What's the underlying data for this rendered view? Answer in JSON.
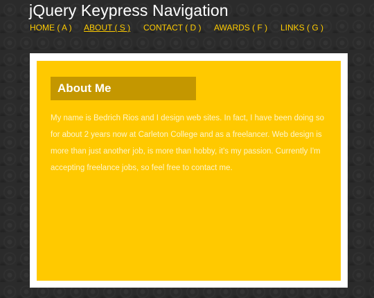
{
  "header": {
    "title": "jQuery Keypress Navigation"
  },
  "nav": {
    "items": [
      {
        "label": "HOME ( A )",
        "active": false
      },
      {
        "label": "ABOUT ( S )",
        "active": true
      },
      {
        "label": "CONTACT ( D )",
        "active": false
      },
      {
        "label": "AWARDS ( F )",
        "active": false
      },
      {
        "label": "LINKS ( G )",
        "active": false
      }
    ]
  },
  "content": {
    "heading": "About Me",
    "body": "My name is Bedrich Rios and I design web sites. In fact, I have been doing so for about 2 years now at Carleton College and as a freelancer. Web design is more than just another job, is more than hobby, it's my passion. Currently I'm accepting freelance jobs, so feel free to contact me."
  },
  "colors": {
    "background": "#2b2b2b",
    "nav_text": "#ffcc00",
    "panel": "#ffc900",
    "panel_border": "#ffffff",
    "heading_bg": "#c49700"
  }
}
